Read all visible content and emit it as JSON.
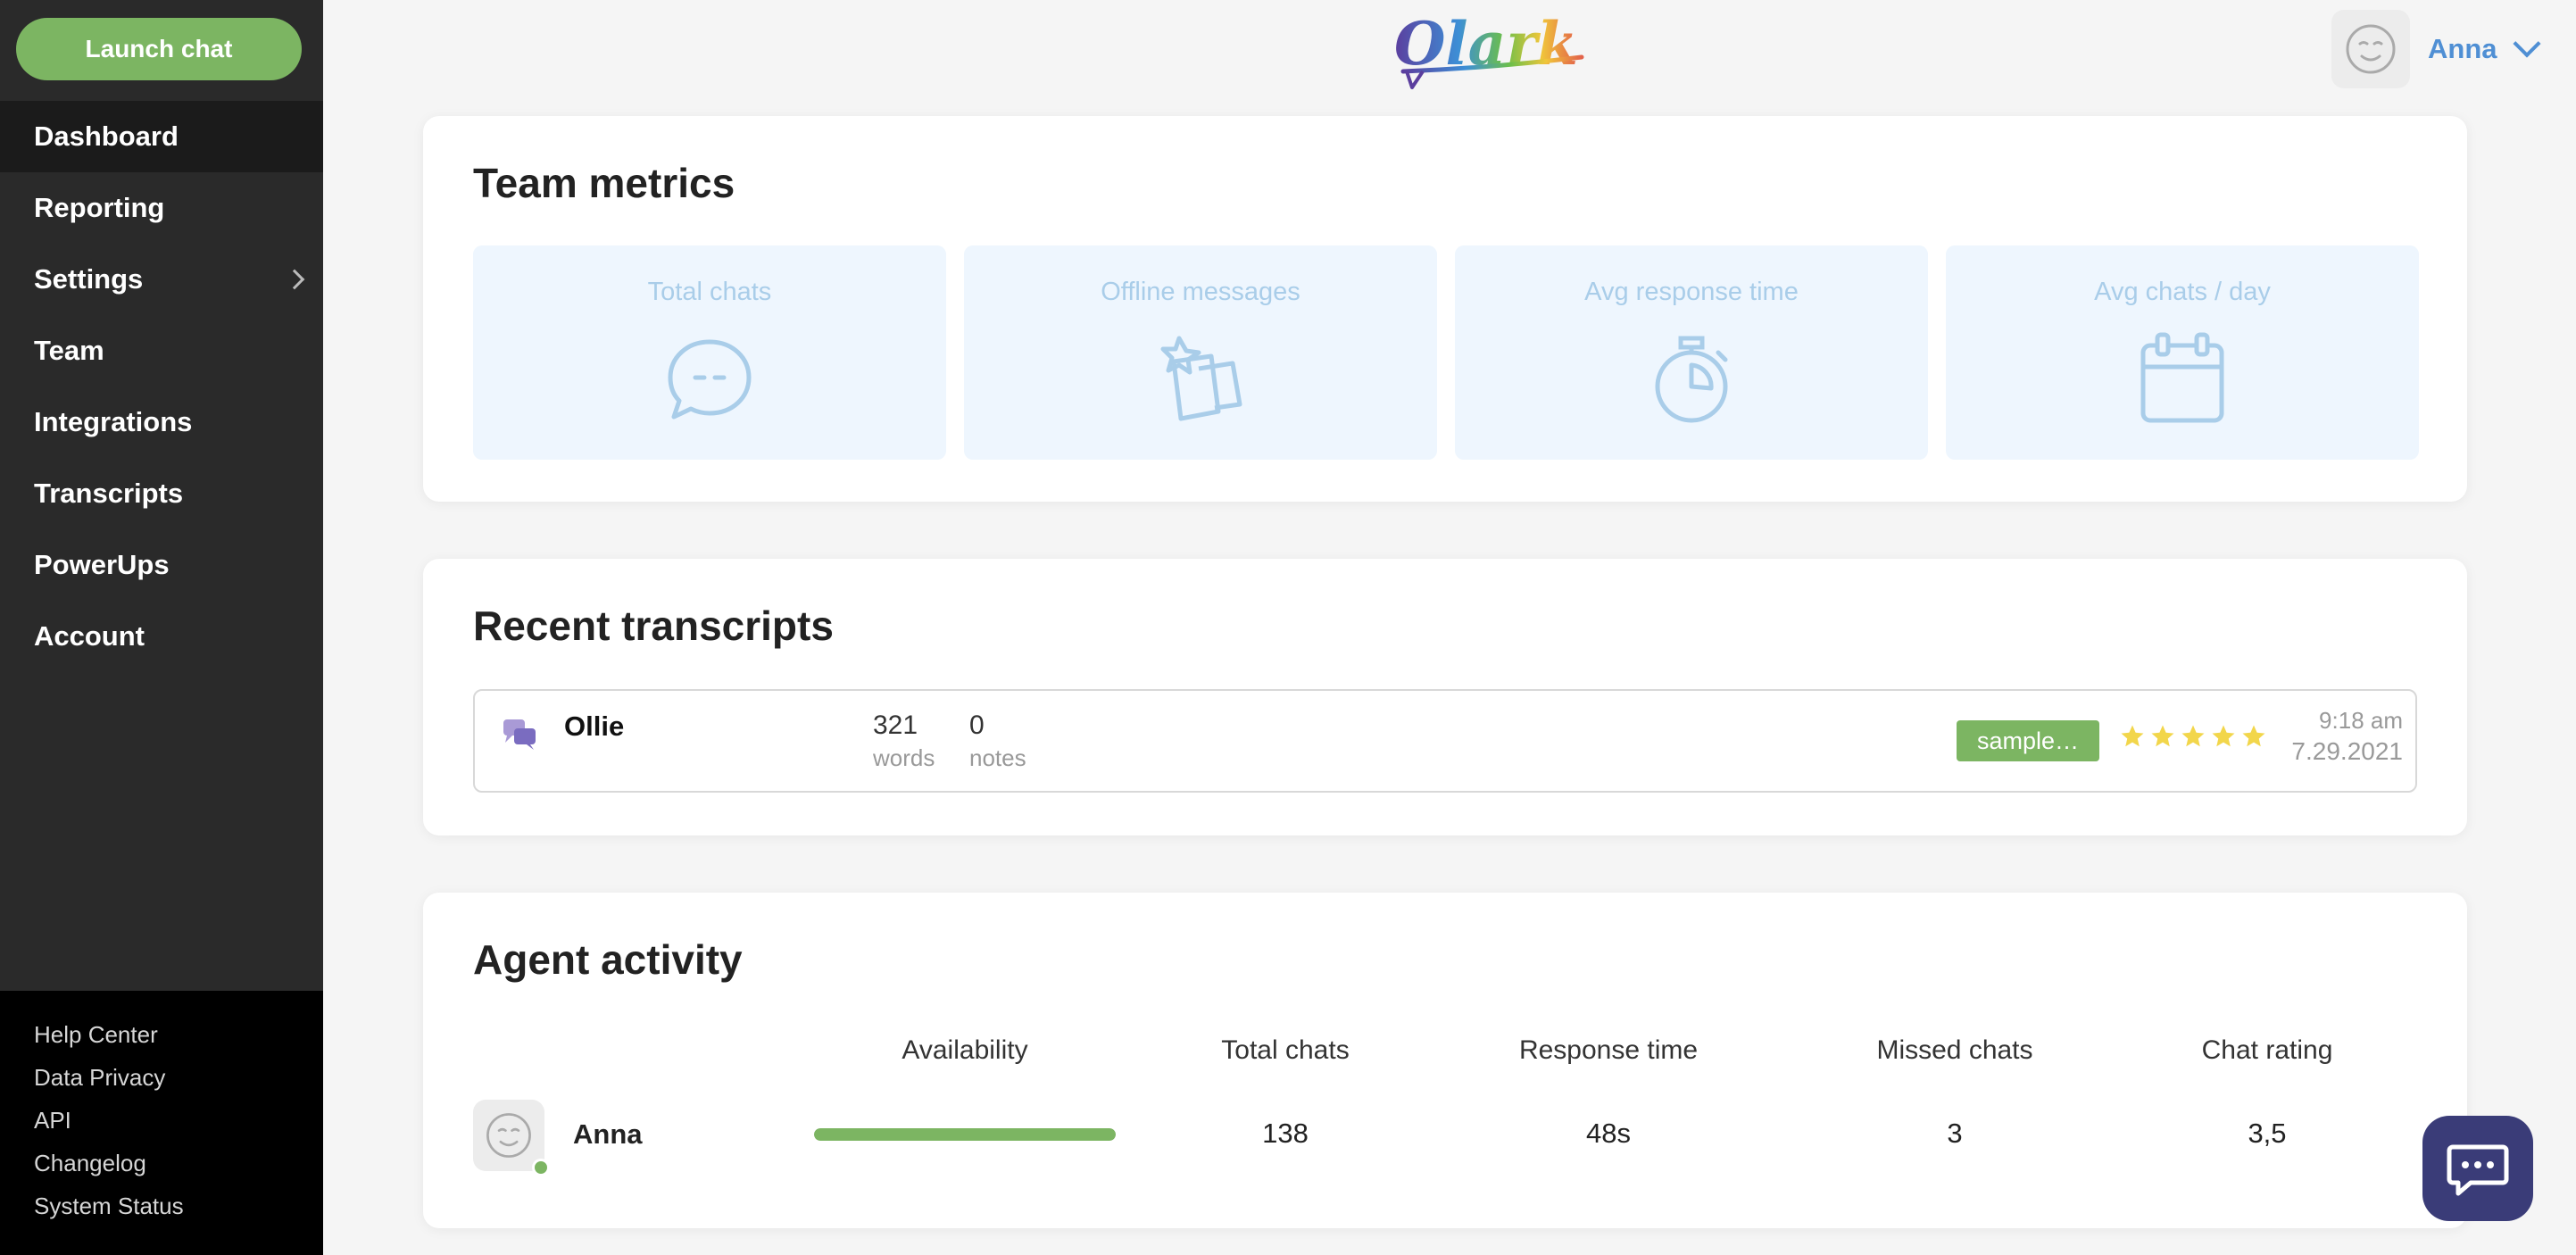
{
  "colors": {
    "accent_green": "#7cb562",
    "sidebar_bg": "#2a2a2a",
    "link_blue": "#4f8fd4",
    "metric_bg": "#eef6fe",
    "metric_text": "#a9cde9",
    "star_yellow": "#f2d64b",
    "chat_bubble": "#3a3c78"
  },
  "sidebar": {
    "launch_chat": "Launch chat",
    "nav": [
      {
        "label": "Dashboard",
        "active": true
      },
      {
        "label": "Reporting"
      },
      {
        "label": "Settings",
        "has_submenu": true
      },
      {
        "label": "Team"
      },
      {
        "label": "Integrations"
      },
      {
        "label": "Transcripts"
      },
      {
        "label": "PowerUps"
      },
      {
        "label": "Account"
      }
    ],
    "footer": [
      "Help Center",
      "Data Privacy",
      "API",
      "Changelog",
      "System Status"
    ]
  },
  "header": {
    "logo_text": "Olark",
    "user_name": "Anna"
  },
  "team_metrics": {
    "title": "Team metrics",
    "cards": [
      {
        "label": "Total chats",
        "icon": "chat-bubble-icon"
      },
      {
        "label": "Offline messages",
        "icon": "sticky-notes-icon"
      },
      {
        "label": "Avg response time",
        "icon": "stopwatch-icon"
      },
      {
        "label": "Avg chats / day",
        "icon": "calendar-icon"
      }
    ]
  },
  "recent_transcripts": {
    "title": "Recent transcripts",
    "items": [
      {
        "name": "Ollie",
        "words": "321",
        "words_label": "words",
        "notes": "0",
        "notes_label": "notes",
        "tag": "sample…",
        "rating": 5,
        "time": "9:18 am",
        "date": "7.29.2021"
      }
    ]
  },
  "agent_activity": {
    "title": "Agent activity",
    "columns": [
      "Availability",
      "Total chats",
      "Response time",
      "Missed chats",
      "Chat rating"
    ],
    "rows": [
      {
        "name": "Anna",
        "availability": 1.0,
        "total_chats": "138",
        "response_time": "48s",
        "missed_chats": "3",
        "chat_rating": "3,5"
      }
    ]
  }
}
